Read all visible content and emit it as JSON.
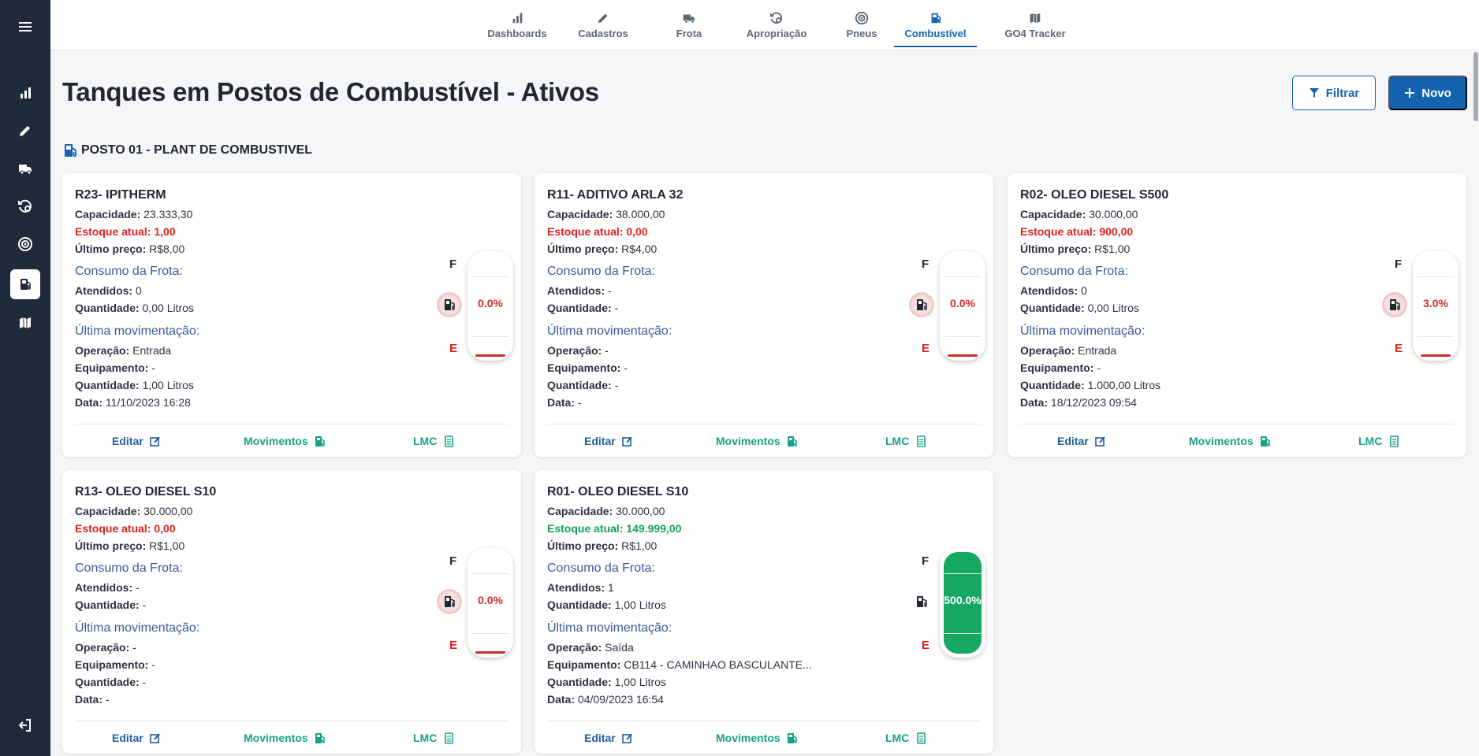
{
  "sidebar": {
    "items": [
      {
        "icon": "menu-icon"
      },
      {
        "icon": "bar-chart-icon"
      },
      {
        "icon": "pencil-icon"
      },
      {
        "icon": "truck-icon"
      },
      {
        "icon": "gear-history-icon"
      },
      {
        "icon": "tire-icon"
      },
      {
        "icon": "fuel-pump-icon",
        "active": true
      },
      {
        "icon": "map-icon"
      },
      {
        "icon": "logout-icon"
      }
    ]
  },
  "nav": {
    "tabs": [
      {
        "label": "Dashboards",
        "icon": "bar-chart-icon"
      },
      {
        "label": "Cadastros",
        "icon": "pencil-icon"
      },
      {
        "label": "Frota",
        "icon": "truck-icon"
      },
      {
        "label": "Apropriação",
        "icon": "gear-history-icon"
      },
      {
        "label": "Pneus",
        "icon": "tire-icon"
      },
      {
        "label": "Combustível",
        "icon": "fuel-pump-icon",
        "active": true
      },
      {
        "label": "GO4 Tracker",
        "icon": "map-icon"
      }
    ]
  },
  "page": {
    "title": "Tanques em Postos de Combustível - Ativos",
    "filter_label": "Filtrar",
    "new_label": "Novo",
    "section_title": "POSTO 01 - PLANT DE COMBUSTIVEL"
  },
  "labels": {
    "capacidade": "Capacidade:",
    "estoque": "Estoque atual:",
    "ultimo_preco": "Último preço:",
    "consumo": "Consumo da Frota:",
    "atendidos": "Atendidos:",
    "quantidade": "Quantidade:",
    "ultima_mov": "Última movimentação:",
    "operacao": "Operação:",
    "equipamento": "Equipamento:",
    "data": "Data:",
    "editar": "Editar",
    "movimentos": "Movimentos",
    "lmc": "LMC",
    "gauge_full": "F",
    "gauge_empty": "E"
  },
  "colors": {
    "primary": "#1463b0",
    "sidebar_bg": "#1f2b3a",
    "stock_red": "#e0201c",
    "stock_green": "#14a05a",
    "action_teal": "#19a085",
    "gauge_fill": "#14a861"
  },
  "tanks": [
    {
      "name": "R23- IPITHERM",
      "capacidade": "23.333,30",
      "estoque": "1,00",
      "estoque_status": "red",
      "ultimo_preco": "R$8,00",
      "atendidos": "0",
      "consumo_quantidade": "0,00 Litros",
      "operacao": "Entrada",
      "equipamento": "-",
      "mov_quantidade": "1,00 Litros",
      "data": "11/10/2023 16:28",
      "gauge_pct": "0.0%",
      "fill_fraction": 0.0
    },
    {
      "name": "R11- ADITIVO ARLA 32",
      "capacidade": "38.000,00",
      "estoque": "0,00",
      "estoque_status": "red",
      "ultimo_preco": "R$4,00",
      "atendidos": "-",
      "consumo_quantidade": "-",
      "operacao": "-",
      "equipamento": "-",
      "mov_quantidade": "-",
      "data": "-",
      "gauge_pct": "0.0%",
      "fill_fraction": 0.0
    },
    {
      "name": "R02- OLEO DIESEL S500",
      "capacidade": "30.000,00",
      "estoque": "900,00",
      "estoque_status": "red",
      "ultimo_preco": "R$1,00",
      "atendidos": "0",
      "consumo_quantidade": "0,00 Litros",
      "operacao": "Entrada",
      "equipamento": "-",
      "mov_quantidade": "1.000,00 Litros",
      "data": "18/12/2023 09:54",
      "gauge_pct": "3.0%",
      "fill_fraction": 0.03
    },
    {
      "name": "R13- OLEO DIESEL S10",
      "capacidade": "30.000,00",
      "estoque": "0,00",
      "estoque_status": "red",
      "ultimo_preco": "R$1,00",
      "atendidos": "-",
      "consumo_quantidade": "-",
      "operacao": "-",
      "equipamento": "-",
      "mov_quantidade": "-",
      "data": "-",
      "gauge_pct": "0.0%",
      "fill_fraction": 0.0
    },
    {
      "name": "R01- OLEO DIESEL S10",
      "capacidade": "30.000,00",
      "estoque": "149.999,00",
      "estoque_status": "green",
      "ultimo_preco": "R$1,00",
      "atendidos": "1",
      "consumo_quantidade": "1,00 Litros",
      "operacao": "Saída",
      "equipamento": "CB114 - CAMINHAO BASCULANTE...",
      "mov_quantidade": "1,00 Litros",
      "data": "04/09/2023 16:54",
      "gauge_pct": "500.0%",
      "fill_fraction": 1.0
    }
  ]
}
